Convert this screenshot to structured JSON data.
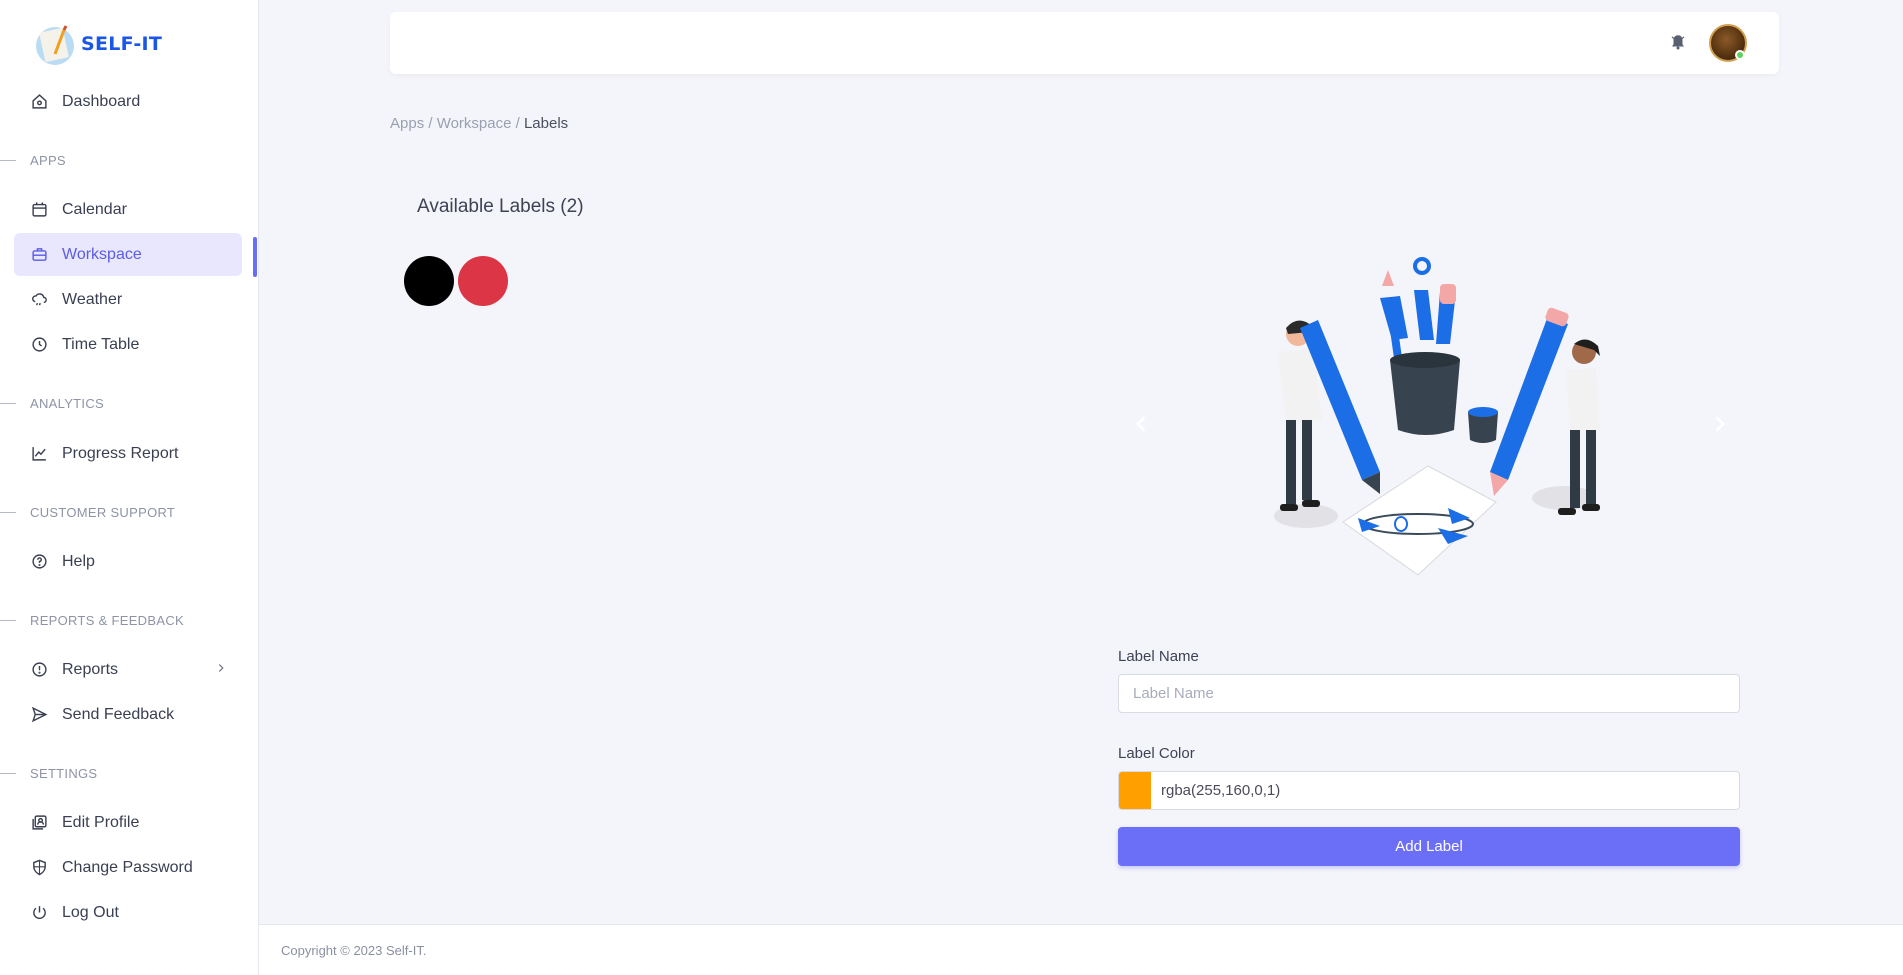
{
  "brand": {
    "name": "SELF-IT"
  },
  "sidebar": {
    "dashboard": "Dashboard",
    "sections": {
      "apps": "APPS",
      "analytics": "ANALYTICS",
      "support": "CUSTOMER SUPPORT",
      "reports": "REPORTS & FEEDBACK",
      "settings": "SETTINGS"
    },
    "items": {
      "calendar": "Calendar",
      "workspace": "Workspace",
      "weather": "Weather",
      "timetable": "Time Table",
      "progress": "Progress Report",
      "help": "Help",
      "reports": "Reports",
      "feedback": "Send Feedback",
      "edit_profile": "Edit Profile",
      "change_password": "Change Password",
      "logout": "Log Out"
    },
    "active_item": "Workspace"
  },
  "breadcrumb": {
    "part1": "Apps / ",
    "part2": "Workspace / ",
    "current": "Labels"
  },
  "labels": {
    "title": "Available Labels (2)",
    "colors": [
      "#000000",
      "#dc3545"
    ]
  },
  "form": {
    "name_label": "Label Name",
    "name_placeholder": "Label Name",
    "name_value": "",
    "color_label": "Label Color",
    "color_value": "rgba(255,160,0,1)",
    "swatch_color": "#ffa000",
    "submit": "Add Label"
  },
  "footer": {
    "copyright": "Copyright © 2023 Self-IT."
  },
  "colors": {
    "accent": "#6b6ef7",
    "brand": "#1a56e8"
  }
}
